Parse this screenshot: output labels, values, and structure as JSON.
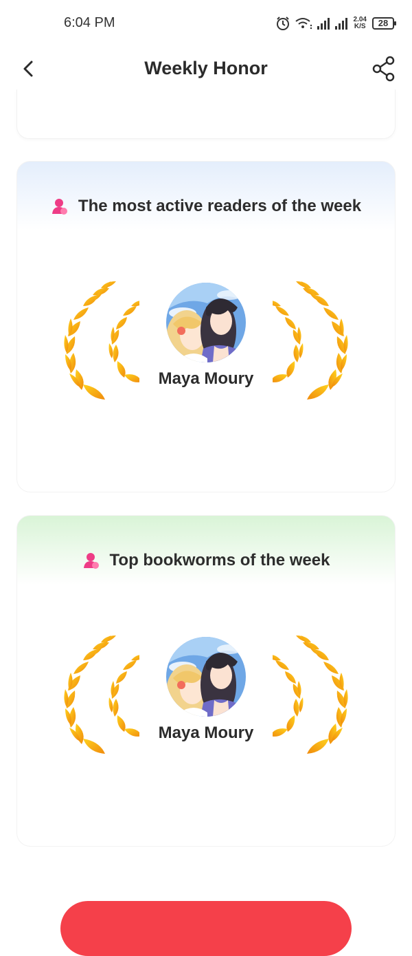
{
  "status_bar": {
    "time": "6:04 PM",
    "speed_value": "2.04",
    "speed_unit": "K/S",
    "battery": "28"
  },
  "header": {
    "title": "Weekly Honor",
    "back_icon": "chevron-left-icon",
    "share_icon": "share-icon"
  },
  "sections": [
    {
      "title": "The most active readers of the week",
      "icon": "person-icon",
      "user_name": "Maya Moury",
      "header_color": "#e4eefc"
    },
    {
      "title": "Top bookworms of the week",
      "icon": "person-icon",
      "user_name": "Maya Moury",
      "header_color": "#d9f4d7"
    }
  ],
  "colors": {
    "accent_button": "#f5404a",
    "icon_pink": "#ee3c86",
    "laurel_gold": "#f7b21c",
    "laurel_orange": "#f07d0c"
  }
}
